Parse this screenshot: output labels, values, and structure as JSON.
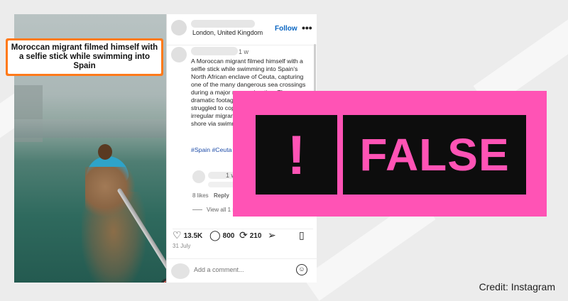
{
  "video": {
    "caption": "Moroccan migrant filmed himself with a selfie stick while swimming into Spain",
    "mute_icon": "speaker-muted-icon"
  },
  "post": {
    "location": "London, United Kingdom",
    "follow_label": "Follow",
    "more_icon": "•••",
    "caption_time": "1 w",
    "caption_text": "A Moroccan migrant filmed himself with a selfie stick while swimming into Spain's North African enclave of Ceuta, capturing one of the many dangerous sea crossings during a major mass migration. The dramatic footage comes as authorities struggled to cope with thousands of irregular migrants, many of whom reached shore via swimming around border fences.",
    "hashtags": "#Spain #Ceuta #Morocco #BreakingNews",
    "reply_time": "1 w",
    "reply_likes": "8 likes",
    "reply_label": "Reply",
    "view_all": "View all 1 replies",
    "like_count": "13.5K",
    "comment_count": "800",
    "repost_count": "210",
    "date": "31 July",
    "comment_placeholder": "Add a comment..."
  },
  "overlay": {
    "bang": "!",
    "label": "FALSE",
    "color": "#ff53b5"
  },
  "credit": "Credit: Instagram"
}
